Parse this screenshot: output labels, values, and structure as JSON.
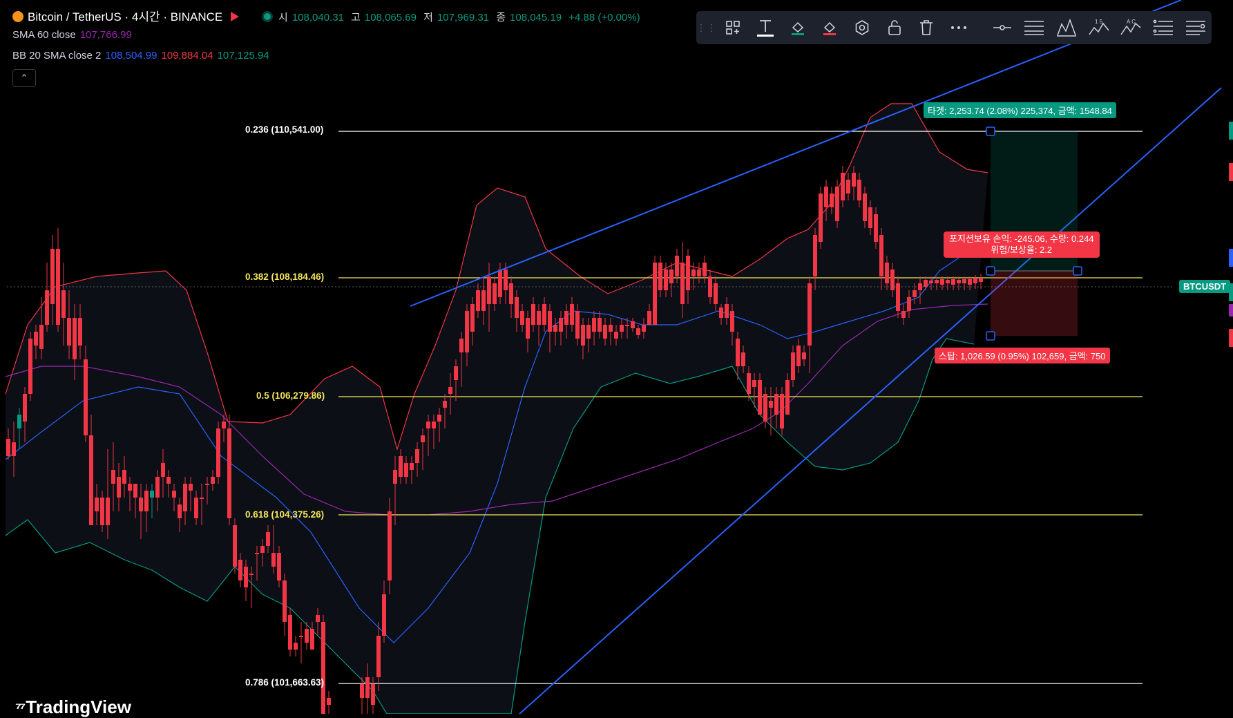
{
  "header": {
    "symbol": "Bitcoin / TetherUS · 4시간 · BINANCE",
    "ohlc": [
      {
        "k": "시",
        "v": "108,040.31"
      },
      {
        "k": "고",
        "v": "108,065.69"
      },
      {
        "k": "저",
        "v": "107,969.31"
      },
      {
        "k": "종",
        "v": "108,045.19"
      }
    ],
    "change": "+4.88 (+0.00%)",
    "sma_label": "SMA 60 close",
    "sma_value": "107,766.99",
    "bb_label": "BB 20 SMA close 2",
    "bb_basis": "108,504.99",
    "bb_upper": "109,884.04",
    "bb_lower": "107,125.94",
    "collapse_icon": "chevron-up-icon"
  },
  "toolbar": {
    "icons": [
      "drag-grip-icon",
      "object-tree-icon",
      "text-icon",
      "fill-color-icon",
      "line-color-icon",
      "settings-icon",
      "lock-icon",
      "trash-icon",
      "more-icon",
      "line-style-icon",
      "hamburger-lines-icon",
      "pattern-icon",
      "wave-15-icon",
      "wave-ac-icon",
      "list-lines-icon",
      "list-settings-icon"
    ],
    "labels": {
      "wave15": "1 5",
      "waveac": "A C"
    }
  },
  "fib_levels": [
    {
      "ratio": "0.236",
      "price": "110,541.00",
      "color": "#ffffff"
    },
    {
      "ratio": "0.382",
      "price": "108,184.46",
      "color": "#f5e65c"
    },
    {
      "ratio": "0.5",
      "price": "106,279.86",
      "color": "#f5e65c"
    },
    {
      "ratio": "0.618",
      "price": "104,375.26",
      "color": "#f5e65c"
    },
    {
      "ratio": "0.786",
      "price": "101,663.63",
      "color": "#ffffff"
    }
  ],
  "position": {
    "target": "타겟: 2,253.74 (2.08%) 225,374, 금액: 1548.84",
    "pnl_line1": "포지션보유 손익: -245.06, 수량: 0.244",
    "pnl_line2": "위험/보상율: 2.2",
    "stop": "스탑: 1,026.59 (0.95%) 102,659, 금액: 750"
  },
  "price_axis": {
    "symbol_label": "BTCUSDT"
  },
  "branding": {
    "logo": "TradingView"
  },
  "colors": {
    "up": "#089981",
    "down": "#f23645",
    "bb_upper": "#f23645",
    "bb_basis": "#2962ff",
    "bb_lower": "#089981",
    "sma": "#9c27b0",
    "trend": "#2962ff"
  }
}
